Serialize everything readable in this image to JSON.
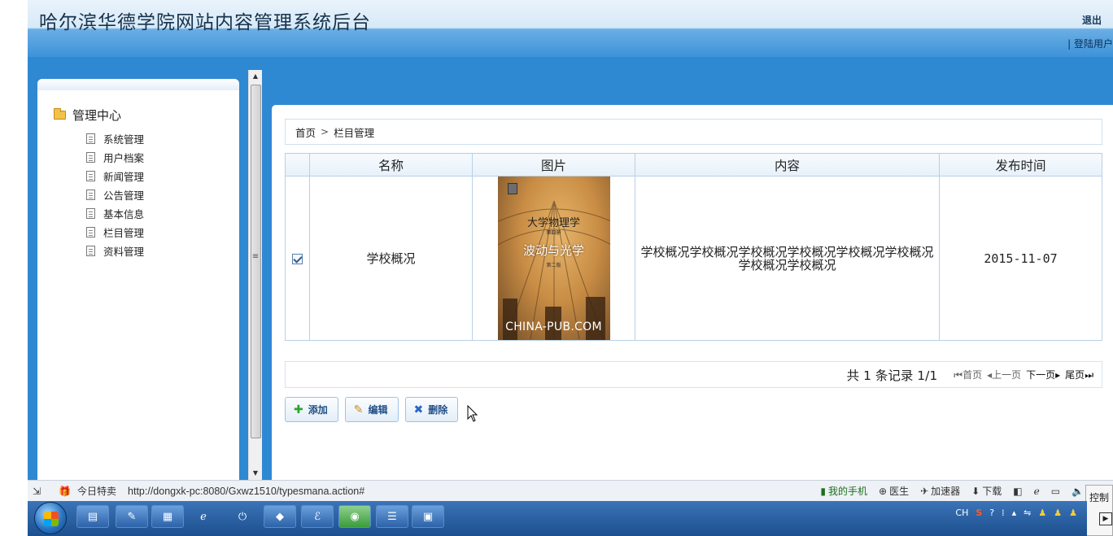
{
  "header": {
    "site_title": "哈尔滨华德学院网站内容管理系统后台",
    "logout_label": "退出",
    "login_user_label": "| 登陆用户"
  },
  "sidebar": {
    "root_label": "管理中心",
    "items": [
      {
        "label": "系统管理"
      },
      {
        "label": "用户档案"
      },
      {
        "label": "新闻管理"
      },
      {
        "label": "公告管理"
      },
      {
        "label": "基本信息"
      },
      {
        "label": "栏目管理"
      },
      {
        "label": "资料管理"
      }
    ]
  },
  "breadcrumb": {
    "home": "首页",
    "separator": ">",
    "current": "栏目管理"
  },
  "table": {
    "columns": [
      "",
      "名称",
      "图片",
      "内容",
      "发布时间"
    ],
    "rows": [
      {
        "checked": true,
        "name": "学校概况",
        "image": {
          "title": "大学物理学",
          "volume": "第四册",
          "subtitle": "波动与光学",
          "edition": "第二版",
          "watermark": "CHINA-PUB.COM"
        },
        "content": "学校概况学校概况学校概况学校概况学校概况学校概况学校概况学校概况",
        "date": "2015-11-07"
      }
    ]
  },
  "pager": {
    "info": "共 1 条记录 1/1",
    "first": "首页",
    "prev": "上一页",
    "next": "下一页",
    "last": "尾页"
  },
  "actions": {
    "add": "添加",
    "edit": "编辑",
    "delete": "删除"
  },
  "statusbar": {
    "deal_label": "今日特卖",
    "url": "http://dongxk-pc:8080/Gxwz1510/typesmana.action#",
    "my_phone": "我的手机",
    "doctor": "医生",
    "accelerator": "加速器",
    "download": "下载"
  },
  "side_tab_label": "控制",
  "tray": {
    "ime": "CH"
  },
  "colors": {
    "header_blue": "#3d93d8",
    "band_blue": "#2f88d2",
    "table_border": "#b7d0e7",
    "button_text": "#1f4f86"
  }
}
